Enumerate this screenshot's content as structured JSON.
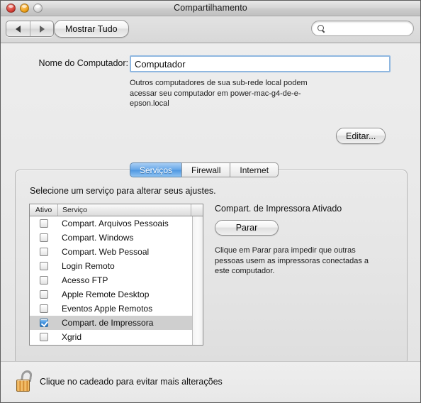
{
  "window": {
    "title": "Compartilhamento",
    "traffic_lights": [
      "close-button",
      "minimize-button",
      "zoom-button"
    ]
  },
  "toolbar": {
    "back_label": "back-arrow",
    "forward_label": "forward-arrow",
    "show_all_label": "Mostrar Tudo",
    "search": {
      "value": "",
      "placeholder": "",
      "icon": "search-icon"
    }
  },
  "computer_name": {
    "label": "Nome do Computador:",
    "value": "Computador",
    "help_text": "Outros computadores de sua sub-rede local podem acessar seu computador em power-mac-g4-de-e-epson.local",
    "edit_button": "Editar..."
  },
  "tabs": [
    {
      "label": "Serviços",
      "selected": true
    },
    {
      "label": "Firewall",
      "selected": false
    },
    {
      "label": "Internet",
      "selected": false
    }
  ],
  "services_pane": {
    "instruction": "Selecione um serviço para alterar seus ajustes.",
    "columns": [
      "Ativo",
      "Serviço"
    ],
    "rows": [
      {
        "name": "Compart. Arquivos Pessoais",
        "checked": false,
        "selected": false
      },
      {
        "name": "Compart. Windows",
        "checked": false,
        "selected": false
      },
      {
        "name": "Compart. Web Pessoal",
        "checked": false,
        "selected": false
      },
      {
        "name": "Login Remoto",
        "checked": false,
        "selected": false
      },
      {
        "name": "Acesso FTP",
        "checked": false,
        "selected": false
      },
      {
        "name": "Apple Remote Desktop",
        "checked": false,
        "selected": false
      },
      {
        "name": "Eventos Apple Remotos",
        "checked": false,
        "selected": false
      },
      {
        "name": "Compart. de Impressora",
        "checked": true,
        "selected": true
      },
      {
        "name": "Xgrid",
        "checked": false,
        "selected": false
      }
    ]
  },
  "detail": {
    "title": "Compart. de Impressora Ativado",
    "action_button": "Parar",
    "description": "Clique em Parar para impedir que outras pessoas usem as impressoras conectadas a este computador."
  },
  "help": {
    "label": "?"
  },
  "lock_bar": {
    "icon": "unlocked-padlock-icon",
    "text": "Clique no cadeado para evitar mais alterações"
  },
  "colors": {
    "tab_selected": "#4e97e2",
    "checkbox_on": "#3c8ede",
    "selection_row": "#cfcfcf",
    "help_button": "#bfa4e2",
    "lock_gold": "#d9933a"
  }
}
